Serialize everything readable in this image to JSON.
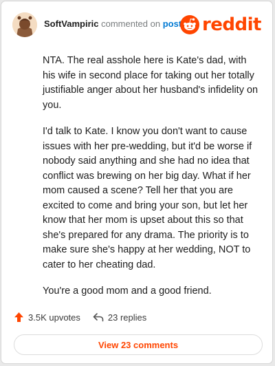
{
  "header": {
    "username": "SoftVampiric",
    "action_text": "commented on",
    "post_link_text": "post",
    "logo_text": "reddit",
    "brand_color": "#ff4500",
    "link_color": "#0079d3"
  },
  "comment": {
    "paragraphs": [
      "NTA. The real asshole here is Kate's dad, with his wife in second place for taking out her totally justifiable anger about her husband's infidelity on you.",
      "I'd talk to Kate. I know you don't want to cause issues with her pre-wedding, but it'd be worse if nobody said anything and she had no idea that conflict was brewing on her big day. What if her mom caused a scene? Tell her that you are excited to come and bring your son, but let her know that her mom is upset about this so that she's prepared for any drama. The priority is to make sure she's happy at her wedding, NOT to cater to her cheating dad.",
      "You're a good mom and a good friend."
    ]
  },
  "footer": {
    "upvotes_label": "3.5K upvotes",
    "replies_label": "23 replies",
    "view_comments_label": "View 23 comments"
  },
  "icons": {
    "avatar": "avatar-icon",
    "logo": "reddit-logo-icon",
    "upvote": "upvote-arrow-icon",
    "reply": "reply-arrow-icon"
  }
}
